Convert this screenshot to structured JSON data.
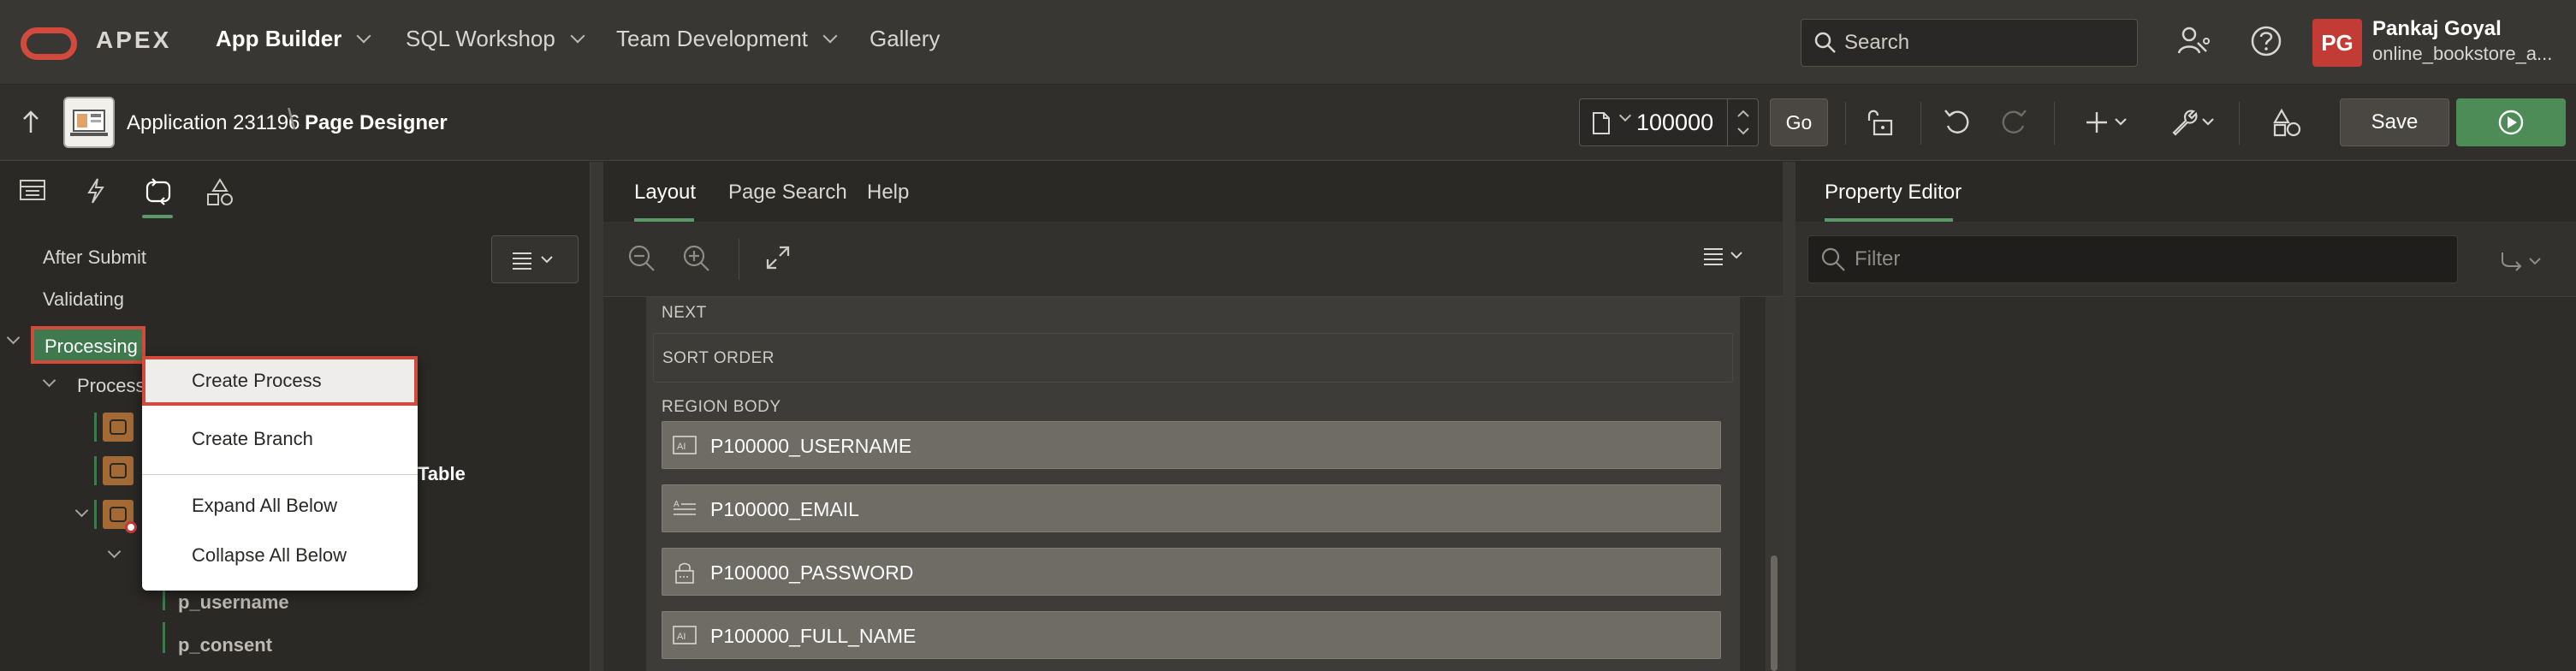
{
  "header": {
    "brand": "APEX",
    "nav": [
      {
        "label": "App Builder",
        "has_menu": true,
        "active": true
      },
      {
        "label": "SQL Workshop",
        "has_menu": true
      },
      {
        "label": "Team Development",
        "has_menu": true
      },
      {
        "label": "Gallery",
        "has_menu": false
      }
    ],
    "search_placeholder": "Search",
    "user": {
      "initials": "PG",
      "name": "Pankaj Goyal",
      "workspace": "online_bookstore_a..."
    }
  },
  "toolbar": {
    "breadcrumb_app": "Application 231196",
    "breadcrumb_page": "Page Designer",
    "page_number": "100000",
    "go_label": "Go",
    "save_label": "Save"
  },
  "left_panel": {
    "tree": {
      "after_submit": "After Submit",
      "validating": "Validating",
      "processing": "Processing",
      "processes": "Process",
      "table_fragment": "Table",
      "param1": "p_username",
      "param2": "p_consent"
    },
    "context_menu": {
      "items": [
        "Create Process",
        "Create Branch",
        "Expand All Below",
        "Collapse All Below"
      ]
    }
  },
  "center_panel": {
    "tabs": [
      "Layout",
      "Page Search",
      "Help"
    ],
    "regions": {
      "next": "NEXT",
      "sort_order": "SORT ORDER",
      "region_body": "REGION BODY"
    },
    "fields": [
      "P100000_USERNAME",
      "P100000_EMAIL",
      "P100000_PASSWORD",
      "P100000_FULL_NAME"
    ]
  },
  "right_panel": {
    "tab": "Property Editor",
    "filter_placeholder": "Filter"
  },
  "colors": {
    "accent_green": "#4d8c57",
    "highlight_red": "#d24a3c",
    "tree_green": "#3f7a4e",
    "avatar_red": "#c23b34"
  }
}
